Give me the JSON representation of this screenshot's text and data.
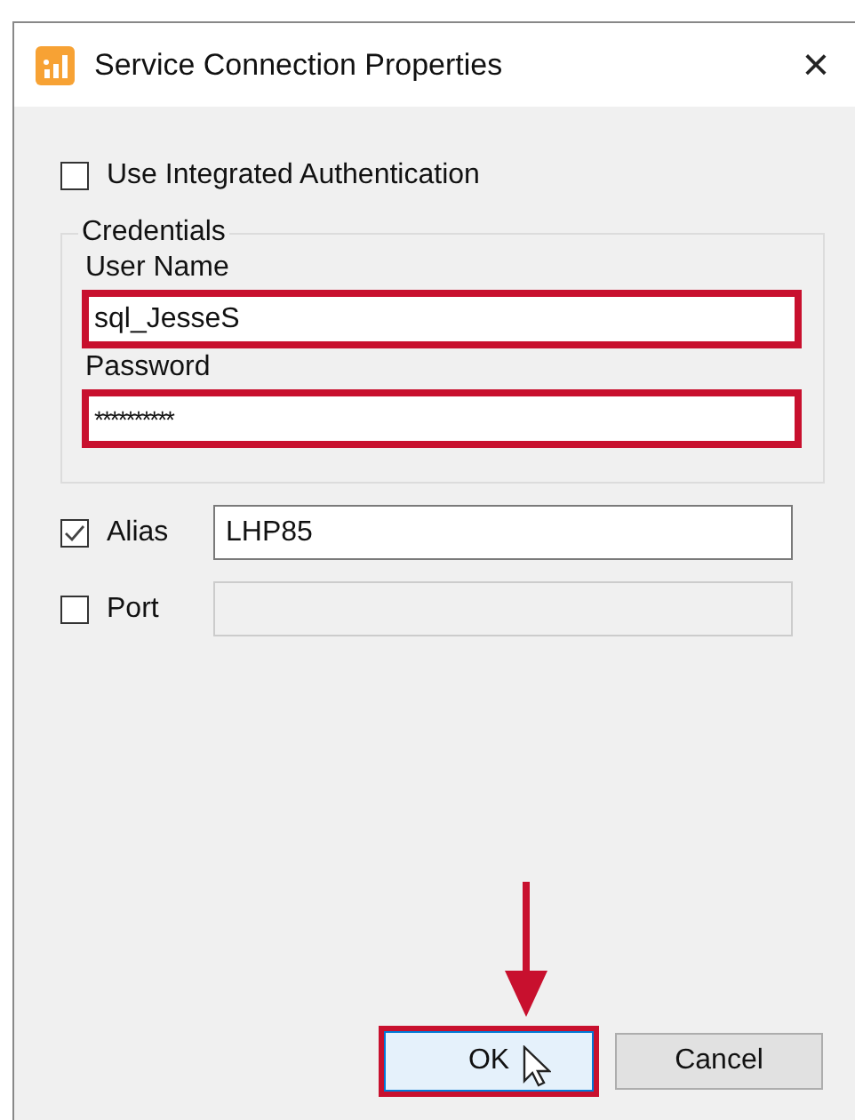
{
  "window": {
    "title": "Service Connection Properties",
    "close": "×"
  },
  "integrated_auth": {
    "label": "Use Integrated Authentication",
    "checked": false
  },
  "credentials": {
    "title": "Credentials",
    "fields": [
      {
        "label": "User Name",
        "value": "sql_JesseS",
        "highlighted": true
      },
      {
        "label": "Password",
        "value": "**********",
        "highlighted": true
      }
    ]
  },
  "options": [
    {
      "label": "Alias",
      "checked": true,
      "value": "LHP85",
      "disabled": false
    },
    {
      "label": "Port",
      "checked": false,
      "disabled": true
    }
  ],
  "buttons": [
    {
      "label": "OK",
      "highlighted": true,
      "hovered": true
    },
    {
      "label": "Cancel",
      "highlighted": false,
      "hovered": false
    }
  ]
}
